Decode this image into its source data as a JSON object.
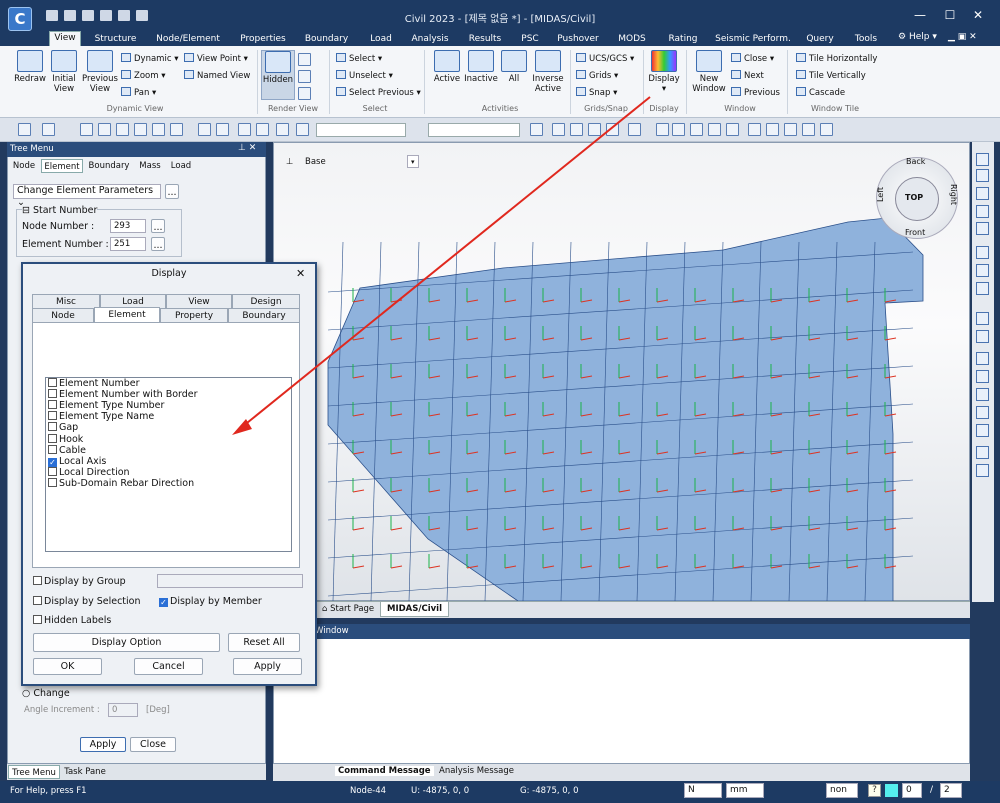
{
  "title": "Civil 2023 - [제목 없음 *] - [MIDAS/Civil]",
  "ribbon_tabs": [
    "View",
    "Structure",
    "Node/Element",
    "Properties",
    "Boundary",
    "Load",
    "Analysis",
    "Results",
    "PSC",
    "Pushover",
    "MODS",
    "Rating",
    "Seismic Perform.",
    "Query",
    "Tools"
  ],
  "help_label": "Help",
  "dynamic_view": {
    "redraw": "Redraw",
    "initial": "Initial\nView",
    "previous": "Previous\nView",
    "dynamic": "Dynamic",
    "zoom": "Zoom",
    "pan": "Pan",
    "view_point": "View Point",
    "named_view": "Named View",
    "group": "Dynamic View"
  },
  "render_view": {
    "hidden": "Hidden",
    "group": "Render View"
  },
  "select_grp": {
    "select": "Select",
    "unselect": "Unselect",
    "select_previous": "Select Previous",
    "group": "Select"
  },
  "activities": {
    "active": "Active",
    "inactive": "Inactive",
    "all": "All",
    "inverse": "Inverse\nActive",
    "group": "Activities"
  },
  "grids": {
    "ucs": "UCS/GCS",
    "grids": "Grids",
    "snap": "Snap",
    "group": "Grids/Snap"
  },
  "display_grp": {
    "display": "Display",
    "group": "Display"
  },
  "window_grp": {
    "new": "New\nWindow",
    "close": "Close",
    "next": "Next",
    "previous": "Previous",
    "group": "Window"
  },
  "window_tile": {
    "h": "Tile Horizontally",
    "v": "Tile Vertically",
    "cascade": "Cascade",
    "group": "Window Tile"
  },
  "tree": {
    "header": "Tree Menu",
    "tabs": [
      "Node",
      "Element",
      "Boundary",
      "Mass",
      "Load"
    ],
    "function": "Change Element Parameters",
    "start_number": "Start Number",
    "node_label": "Node Number",
    "node_val": "293",
    "elem_label": "Element Number",
    "elem_val": "251",
    "change": "Change",
    "angle_label": "Angle Increment :",
    "angle_val": "0",
    "angle_unit": "[Deg]",
    "apply": "Apply",
    "close": "Close",
    "bottom_tabs": [
      "Tree Menu",
      "Task Pane"
    ]
  },
  "viewport": {
    "base": "Base",
    "nav": {
      "back": "Back",
      "right": "Right",
      "left": "Left",
      "front": "Front",
      "top": "TOP"
    },
    "tabs": [
      "Start Page",
      "MIDAS/Civil"
    ]
  },
  "message": {
    "header": "Window",
    "tabs": [
      "Command Message",
      "Analysis Message"
    ]
  },
  "dialog": {
    "title": "Display",
    "tabs_row1": [
      "Misc",
      "Load",
      "View",
      "Design"
    ],
    "tabs_row2": [
      "Node",
      "Element",
      "Property",
      "Boundary"
    ],
    "items": [
      {
        "label": "Element Number",
        "checked": false
      },
      {
        "label": "Element Number with Border",
        "checked": false
      },
      {
        "label": "Element Type Number",
        "checked": false
      },
      {
        "label": "Element Type Name",
        "checked": false
      },
      {
        "label": "Gap",
        "checked": false
      },
      {
        "label": "Hook",
        "checked": false
      },
      {
        "label": "Cable",
        "checked": false
      },
      {
        "label": "Local Axis",
        "checked": true
      },
      {
        "label": "Local Direction",
        "checked": false
      },
      {
        "label": "Sub-Domain Rebar Direction",
        "checked": false
      }
    ],
    "by_group": "Display by Group",
    "by_selection": "Display by Selection",
    "by_member": "Display by Member",
    "hidden_labels": "Hidden Labels",
    "display_option": "Display Option",
    "reset_all": "Reset All",
    "ok": "OK",
    "cancel": "Cancel",
    "apply": "Apply"
  },
  "status": {
    "help": "For Help, press F1",
    "node": "Node-44",
    "u": "U: -4875, 0, 0",
    "g": "G: -4875, 0, 0",
    "dir": "N",
    "unit": "mm",
    "non": "non",
    "zero": "0",
    "page": "2",
    "slash": "/",
    "two": "2"
  },
  "colors": {
    "accent": "#1d3a63",
    "mesh": "#8fb2dc",
    "arrow": "#e0281e"
  }
}
